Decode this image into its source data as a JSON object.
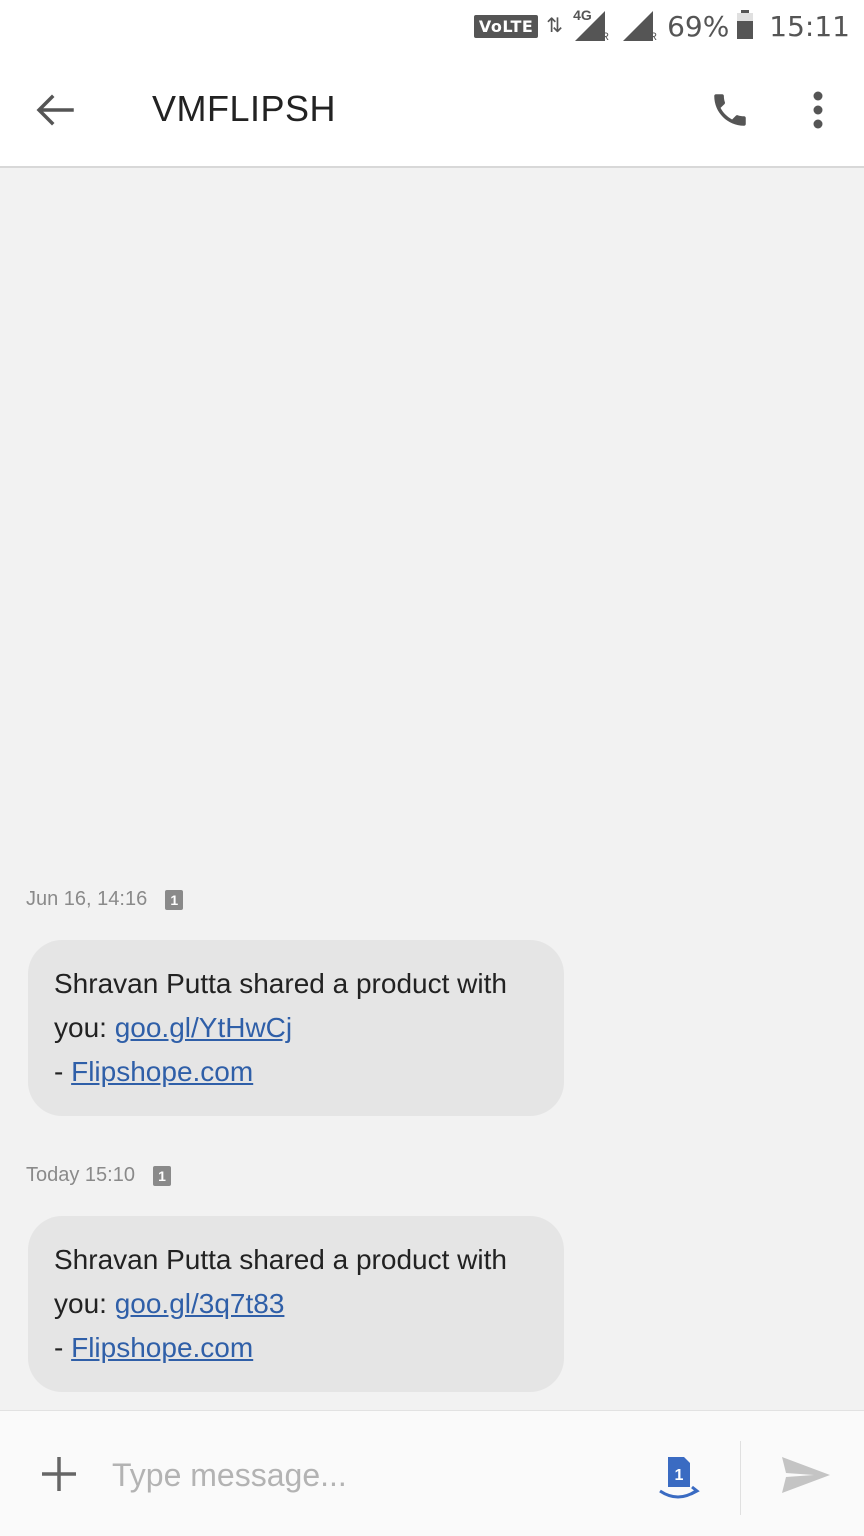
{
  "status_bar": {
    "volte": "VoLTE",
    "network": "4G",
    "roaming_tag": "R",
    "battery_percent": "69%",
    "battery_level": 0.69,
    "time": "15:11"
  },
  "toolbar": {
    "title": "VMFLIPSH"
  },
  "messages": [
    {
      "timestamp": "Jun 16, 14:16",
      "sim": "1",
      "line1": "Shravan Putta shared a product with",
      "prefix": "you: ",
      "link": "goo.gl/YtHwCj",
      "dash": "- ",
      "site": "Flipshope.com"
    },
    {
      "timestamp": "Today 15:10",
      "sim": "1",
      "line1": "Shravan Putta shared a product with",
      "prefix": "you: ",
      "link": "goo.gl/3q7t83",
      "dash": "- ",
      "site": "Flipshope.com"
    }
  ],
  "compose": {
    "placeholder": "Type message...",
    "sim": "1"
  },
  "colors": {
    "background": "#f2f2f2",
    "bubble": "#e5e5e5",
    "link": "#2f5fa8",
    "sim_select": "#3a6bc2"
  }
}
